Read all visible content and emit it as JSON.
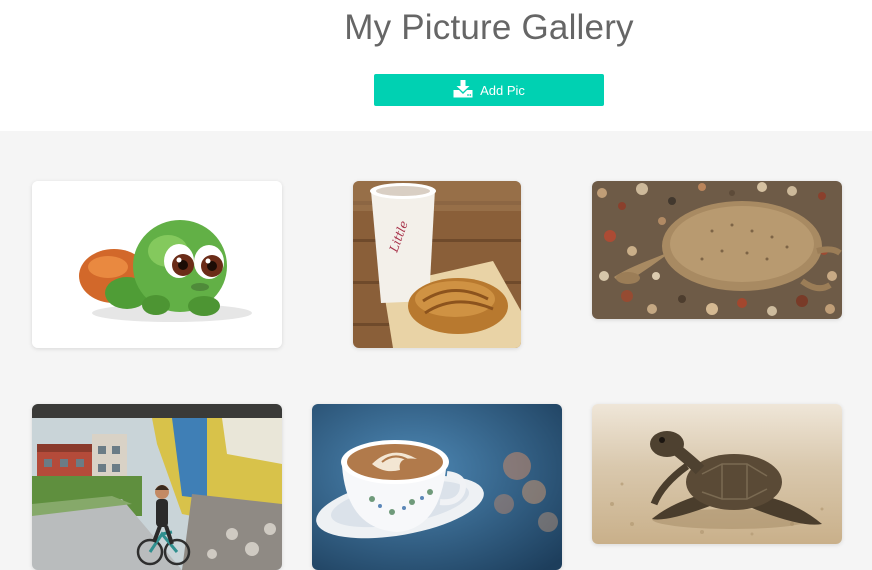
{
  "header": {
    "title": "My Picture Gallery",
    "add_button_label": "Add Pic",
    "add_button_icon": "download-icon"
  },
  "colors": {
    "accent": "#00d1b2",
    "gallery_background": "#f5f5f5",
    "title": "#666666"
  },
  "gallery": {
    "pictures": [
      {
        "subject": "green plush turtle toy"
      },
      {
        "subject": "coffee cup and pastry"
      },
      {
        "subject": "softshell turtle on pebbles"
      },
      {
        "subject": "woman cycling on path"
      },
      {
        "subject": "latte art cup and saucer"
      },
      {
        "subject": "baby sea turtle on sand"
      }
    ]
  }
}
